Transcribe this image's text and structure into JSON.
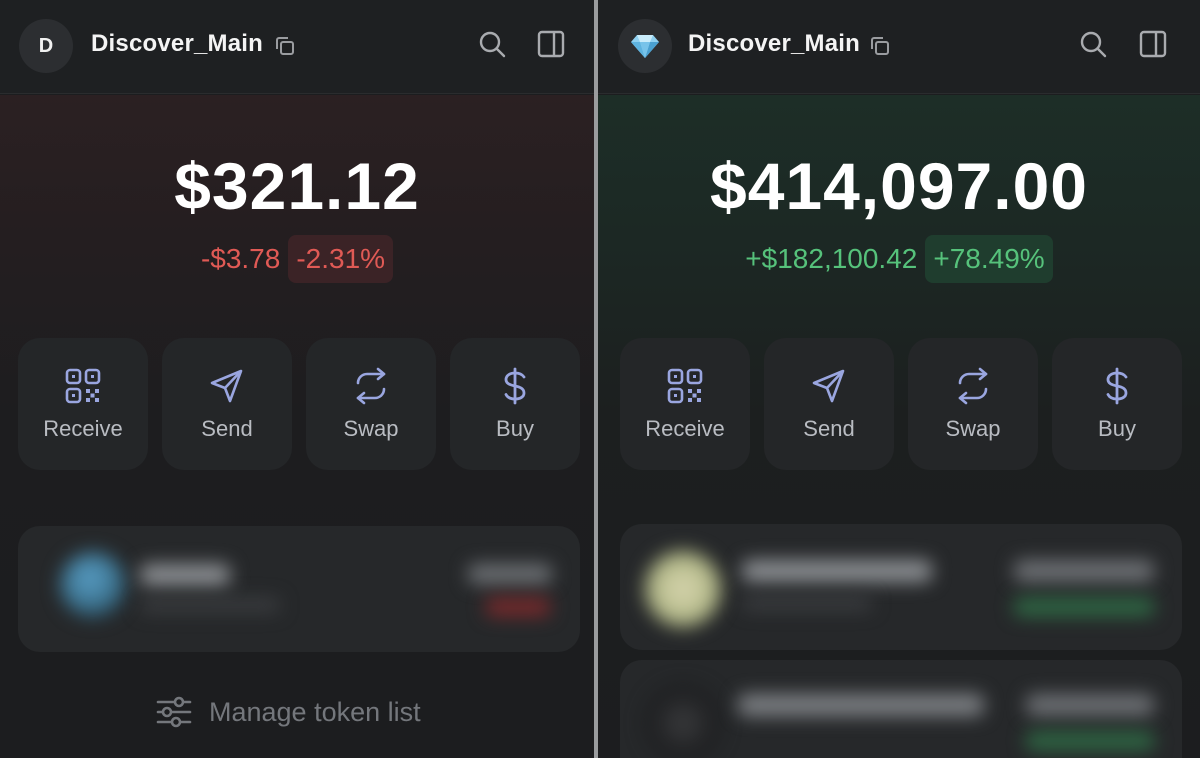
{
  "left": {
    "avatar_letter": "D",
    "account_name": "Discover_Main",
    "balance": "$321.12",
    "change_amount": "-$3.78",
    "change_percent": "-2.31%",
    "actions": [
      {
        "label": "Receive",
        "icon": "qr-code-icon"
      },
      {
        "label": "Send",
        "icon": "send-icon"
      },
      {
        "label": "Swap",
        "icon": "swap-icon"
      },
      {
        "label": "Buy",
        "icon": "dollar-icon"
      }
    ],
    "manage_label": "Manage token list"
  },
  "right": {
    "avatar_icon": "diamond-icon",
    "account_name": "Discover_Main",
    "balance": "$414,097.00",
    "change_amount": "+$182,100.42",
    "change_percent": "+78.49%",
    "actions": [
      {
        "label": "Receive",
        "icon": "qr-code-icon"
      },
      {
        "label": "Send",
        "icon": "send-icon"
      },
      {
        "label": "Swap",
        "icon": "swap-icon"
      },
      {
        "label": "Buy",
        "icon": "dollar-icon"
      }
    ]
  },
  "colors": {
    "negative": "#e05a55",
    "positive": "#56c27b",
    "icon_accent": "#9aa6e0"
  }
}
